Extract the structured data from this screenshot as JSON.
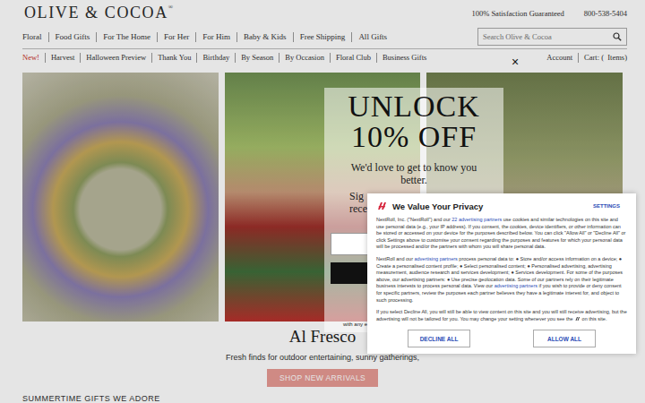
{
  "header": {
    "logo": "OLIVE & COCOA",
    "logo_mark": "®",
    "guarantee": "100% Satisfaction Guaranteed",
    "phone": "800-538-5404"
  },
  "nav_primary": [
    "Floral",
    "Food Gifts",
    "For The Home",
    "For Her",
    "For Him",
    "Baby & Kids",
    "Free Shipping",
    "All Gifts"
  ],
  "search": {
    "placeholder": "Search Olive & Cocoa"
  },
  "nav_secondary": [
    {
      "label": "New!",
      "highlight": true
    },
    {
      "label": "Harvest",
      "highlight": false
    },
    {
      "label": "Halloween Preview",
      "highlight": false
    },
    {
      "label": "Thank You",
      "highlight": false
    },
    {
      "label": "Birthday",
      "highlight": false
    },
    {
      "label": "By Season",
      "highlight": false
    },
    {
      "label": "By Occasion",
      "highlight": false
    },
    {
      "label": "Floral Club",
      "highlight": false
    },
    {
      "label": "Business Gifts",
      "highlight": false
    }
  ],
  "account": {
    "account": "Account",
    "cart": "Cart: (  Items)"
  },
  "popup": {
    "close": "×",
    "title_1": "UNLOCK",
    "title_2": "10% OFF",
    "lead_1": "We'd love to get to know you",
    "lead_2": "better.",
    "line_1": "Sig",
    "line_2": "rece",
    "fine_print": "with any e"
  },
  "feature": {
    "title": "Al Fresco",
    "text": "Fresh finds for outdoor entertaining, sunny gatherings,",
    "button": "SHOP NEW ARRIVALS"
  },
  "section_title": "SUMMERTIME GIFTS WE ADORE",
  "consent": {
    "title": "We Value Your Privacy",
    "settings": "SETTINGS",
    "paragraphs": [
      [
        {
          "kind": "text",
          "text": "NextRoll, Inc. (\"NextRoll\") and our "
        },
        {
          "kind": "link",
          "text": "22 advertising partners"
        },
        {
          "kind": "text",
          "text": " use cookies and similar technologies on this site and use personal data (e.g., your IP address). If you consent, the cookies, device identifiers, or other information can be stored or accessed on your device for the purposes described below. You can click \"Allow All\" or \"Decline All\" or click Settings above to customise your consent regarding the purposes and features for which your personal data will be processed and/or the partners with whom you will share personal data."
        }
      ],
      [
        {
          "kind": "text",
          "text": "NextRoll and our "
        },
        {
          "kind": "link",
          "text": "advertising partners"
        },
        {
          "kind": "text",
          "text": " process personal data to: ● Store and/or access information on a device; ● Create a personalised content profile; ● Select personalised content; ● Personalised advertising, advertising measurement, audience research and services development; ● Services development. For some of the purposes above, our advertising partners: ● Use precise geolocation data. Some of our partners rely on their legitimate business interests to process personal data. View our "
        },
        {
          "kind": "link",
          "text": "advertising partners"
        },
        {
          "kind": "text",
          "text": " if you wish to provide or deny consent for specific partners, review the purposes each partner believes they have a legitimate interest for, and object to such processing."
        }
      ],
      [
        {
          "kind": "text",
          "text": "If you select Decline All, you will still be able to view content on this site and you will still receive advertising, but the advertising will not be tailored for you. You may change your setting whenever you see the "
        },
        {
          "kind": "icon"
        },
        {
          "kind": "text",
          "text": " on this site."
        }
      ]
    ],
    "buttons": [
      "DECLINE ALL",
      "ALLOW ALL"
    ]
  }
}
